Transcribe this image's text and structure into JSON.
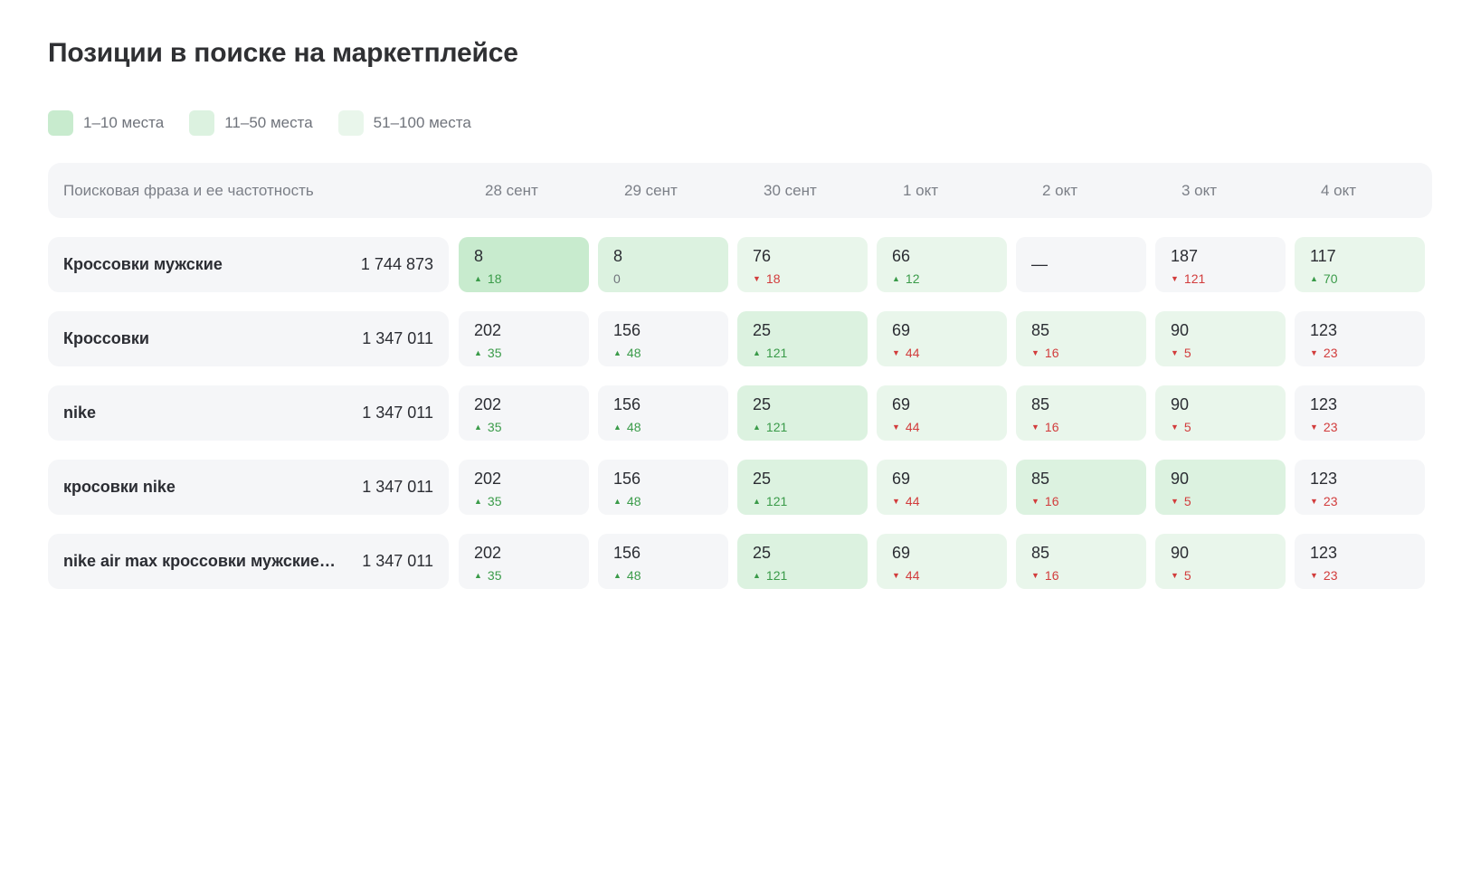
{
  "title": "Позиции в поиске на маркетплейсе",
  "legend": [
    {
      "label": "1–10 места",
      "color": "#c8ebce"
    },
    {
      "label": "11–50 места",
      "color": "#dcf2e0"
    },
    {
      "label": "51–100 места",
      "color": "#e9f6eb"
    }
  ],
  "colors": {
    "up": "#3a9b49",
    "down": "#d23c3c",
    "neutral_cell": "#f5f6f8"
  },
  "table": {
    "first_header": "Поисковая фраза и ее частотность",
    "dates": [
      "28 сент",
      "29 сент",
      "30 сент",
      "1 окт",
      "2 окт",
      "3 окт",
      "4 окт"
    ],
    "rows": [
      {
        "phrase": "Кроссовки мужские",
        "frequency": "1 744 873",
        "cells": [
          {
            "pos": "8",
            "delta": "18",
            "dir": "up",
            "tier": 1
          },
          {
            "pos": "8",
            "delta": "0",
            "dir": "zero",
            "tier": 2
          },
          {
            "pos": "76",
            "delta": "18",
            "dir": "down",
            "tier": 3
          },
          {
            "pos": "66",
            "delta": "12",
            "dir": "up",
            "tier": 3
          },
          {
            "pos": "—",
            "delta": "",
            "dir": "",
            "tier": 0
          },
          {
            "pos": "187",
            "delta": "121",
            "dir": "down",
            "tier": 0
          },
          {
            "pos": "117",
            "delta": "70",
            "dir": "up",
            "tier": 3
          }
        ]
      },
      {
        "phrase": "Кроссовки",
        "frequency": "1 347 011",
        "cells": [
          {
            "pos": "202",
            "delta": "35",
            "dir": "up",
            "tier": 0
          },
          {
            "pos": "156",
            "delta": "48",
            "dir": "up",
            "tier": 0
          },
          {
            "pos": "25",
            "delta": "121",
            "dir": "up",
            "tier": 2
          },
          {
            "pos": "69",
            "delta": "44",
            "dir": "down",
            "tier": 3
          },
          {
            "pos": "85",
            "delta": "16",
            "dir": "down",
            "tier": 3
          },
          {
            "pos": "90",
            "delta": "5",
            "dir": "down",
            "tier": 3
          },
          {
            "pos": "123",
            "delta": "23",
            "dir": "down",
            "tier": 0
          }
        ]
      },
      {
        "phrase": "nike",
        "frequency": "1 347 011",
        "cells": [
          {
            "pos": "202",
            "delta": "35",
            "dir": "up",
            "tier": 0
          },
          {
            "pos": "156",
            "delta": "48",
            "dir": "up",
            "tier": 0
          },
          {
            "pos": "25",
            "delta": "121",
            "dir": "up",
            "tier": 2
          },
          {
            "pos": "69",
            "delta": "44",
            "dir": "down",
            "tier": 3
          },
          {
            "pos": "85",
            "delta": "16",
            "dir": "down",
            "tier": 3
          },
          {
            "pos": "90",
            "delta": "5",
            "dir": "down",
            "tier": 3
          },
          {
            "pos": "123",
            "delta": "23",
            "dir": "down",
            "tier": 0
          }
        ]
      },
      {
        "phrase": "кросовки nike",
        "frequency": "1 347 011",
        "cells": [
          {
            "pos": "202",
            "delta": "35",
            "dir": "up",
            "tier": 0
          },
          {
            "pos": "156",
            "delta": "48",
            "dir": "up",
            "tier": 0
          },
          {
            "pos": "25",
            "delta": "121",
            "dir": "up",
            "tier": 2
          },
          {
            "pos": "69",
            "delta": "44",
            "dir": "down",
            "tier": 3
          },
          {
            "pos": "85",
            "delta": "16",
            "dir": "down",
            "tier": 2
          },
          {
            "pos": "90",
            "delta": "5",
            "dir": "down",
            "tier": 2
          },
          {
            "pos": "123",
            "delta": "23",
            "dir": "down",
            "tier": 0
          }
        ]
      },
      {
        "phrase": "nike air max кроссовки мужские ч...",
        "frequency": "1 347 011",
        "cells": [
          {
            "pos": "202",
            "delta": "35",
            "dir": "up",
            "tier": 0
          },
          {
            "pos": "156",
            "delta": "48",
            "dir": "up",
            "tier": 0
          },
          {
            "pos": "25",
            "delta": "121",
            "dir": "up",
            "tier": 2
          },
          {
            "pos": "69",
            "delta": "44",
            "dir": "down",
            "tier": 3
          },
          {
            "pos": "85",
            "delta": "16",
            "dir": "down",
            "tier": 3
          },
          {
            "pos": "90",
            "delta": "5",
            "dir": "down",
            "tier": 3
          },
          {
            "pos": "123",
            "delta": "23",
            "dir": "down",
            "tier": 0
          }
        ]
      }
    ]
  }
}
